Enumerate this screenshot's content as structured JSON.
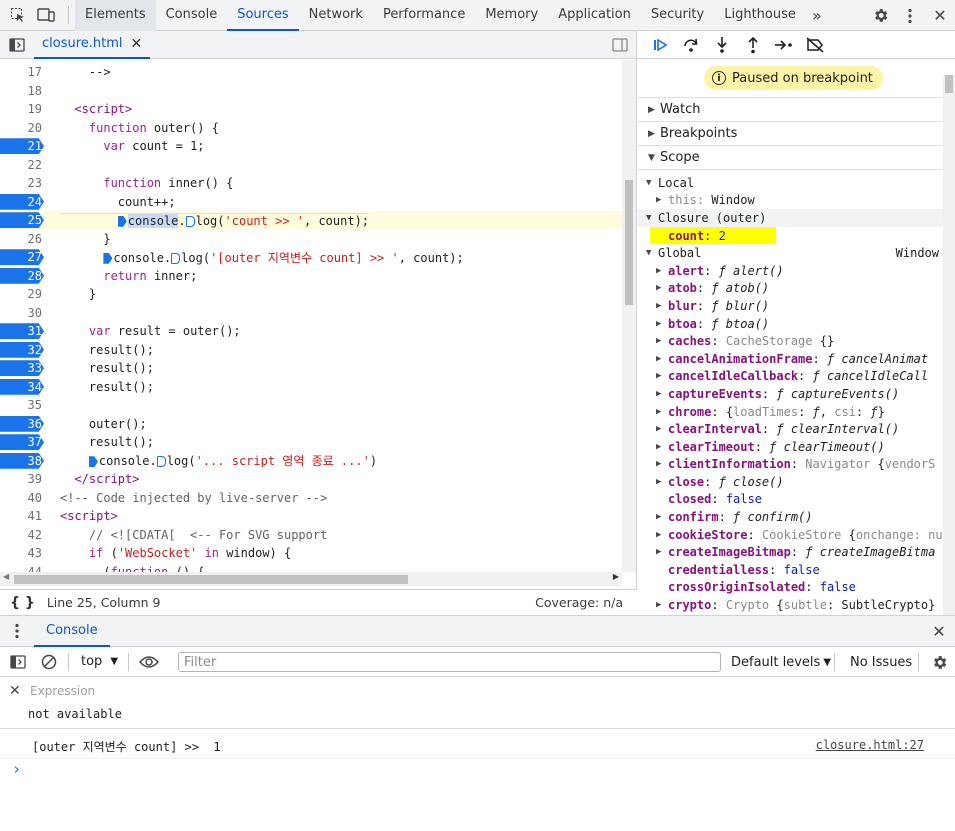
{
  "top_tabs": [
    "Elements",
    "Console",
    "Sources",
    "Network",
    "Performance",
    "Memory",
    "Application",
    "Security",
    "Lighthouse"
  ],
  "active_tab": "Sources",
  "file_tab": "closure.html",
  "code_lines": [
    {
      "n": "17",
      "bp": false,
      "html": "    -->"
    },
    {
      "n": "18",
      "bp": false,
      "html": ""
    },
    {
      "n": "19",
      "bp": false,
      "html": "  <span class='tag'>&lt;script&gt;</span>"
    },
    {
      "n": "20",
      "bp": false,
      "html": "    <span class='kw'>function</span> outer() {"
    },
    {
      "n": "21",
      "bp": true,
      "html": "      <span class='kw'>var</span> count = 1;"
    },
    {
      "n": "22",
      "bp": false,
      "html": ""
    },
    {
      "n": "23",
      "bp": false,
      "html": "      <span class='kw'>function</span> inner() {"
    },
    {
      "n": "24",
      "bp": true,
      "html": "        count++;"
    },
    {
      "n": "25",
      "bp": true,
      "current": true,
      "html": "        <span class='inline-bp'></span><span class='hsel'>console</span>.<span class='inline-bp light'></span>log(<span class='str'>'count &gt;&gt; '</span>, count);"
    },
    {
      "n": "26",
      "bp": false,
      "html": "      }"
    },
    {
      "n": "27",
      "bp": true,
      "html": "      <span class='inline-bp'></span>console.<span class='inline-bp light'></span>log(<span class='str'>'[outer 지역변수 count] &gt;&gt; '</span>, count);"
    },
    {
      "n": "28",
      "bp": true,
      "html": "      <span class='kw'>return</span> inner;"
    },
    {
      "n": "29",
      "bp": false,
      "html": "    }"
    },
    {
      "n": "30",
      "bp": false,
      "html": ""
    },
    {
      "n": "31",
      "bp": true,
      "html": "    <span class='kw'>var</span> result = outer();"
    },
    {
      "n": "32",
      "bp": true,
      "html": "    result();"
    },
    {
      "n": "33",
      "bp": true,
      "html": "    result();"
    },
    {
      "n": "34",
      "bp": true,
      "html": "    result();"
    },
    {
      "n": "35",
      "bp": false,
      "html": ""
    },
    {
      "n": "36",
      "bp": true,
      "html": "    outer();"
    },
    {
      "n": "37",
      "bp": true,
      "html": "    result();"
    },
    {
      "n": "38",
      "bp": true,
      "html": "    <span class='inline-bp'></span>console.<span class='inline-bp light'></span>log(<span class='str'>'... script 영역 종료 ...'</span>)"
    },
    {
      "n": "39",
      "bp": false,
      "html": "  <span class='tag'>&lt;/script&gt;</span>"
    },
    {
      "n": "40",
      "bp": false,
      "html": "<span class='cmt'>&lt;!-- Code injected by live-server --&gt;</span>"
    },
    {
      "n": "41",
      "bp": false,
      "html": "<span class='tag'>&lt;script&gt;</span>"
    },
    {
      "n": "42",
      "bp": false,
      "html": "    <span class='cmt'>// &lt;![CDATA[  &lt;-- For SVG support</span>"
    },
    {
      "n": "43",
      "bp": false,
      "html": "    <span class='kw'>if</span> (<span class='str'>'WebSocket'</span> <span class='kw'>in</span> window) {"
    },
    {
      "n": "44",
      "bp": false,
      "html": "      (<span class='kw'>function</span> () {"
    }
  ],
  "status": {
    "position": "Line 25, Column 9",
    "coverage": "Coverage: n/a"
  },
  "paused_label": "Paused on breakpoint",
  "sections": {
    "watch": "Watch",
    "breakpoints": "Breakpoints",
    "scope": "Scope"
  },
  "scope": {
    "local_label": "Local",
    "this_key": "this",
    "this_val": "Window",
    "closure_label": "Closure (outer)",
    "count_key": "count",
    "count_val": "2",
    "global_label": "Global",
    "global_val": "Window"
  },
  "globals": [
    {
      "k": "alert",
      "html": "<span class='fn'>ƒ alert()</span>",
      "arrow": true
    },
    {
      "k": "atob",
      "html": "<span class='fn'>ƒ atob()</span>",
      "arrow": true
    },
    {
      "k": "blur",
      "html": "<span class='fn'>ƒ blur()</span>",
      "arrow": true
    },
    {
      "k": "btoa",
      "html": "<span class='fn'>ƒ btoa()</span>",
      "arrow": true
    },
    {
      "k": "caches",
      "html": "<span class='gray'>CacheStorage </span>{}",
      "arrow": true
    },
    {
      "k": "cancelAnimationFrame",
      "html": "<span class='fn'>ƒ cancelAnimat</span>",
      "arrow": true
    },
    {
      "k": "cancelIdleCallback",
      "html": "<span class='fn'>ƒ cancelIdleCall</span>",
      "arrow": true
    },
    {
      "k": "captureEvents",
      "html": "<span class='fn'>ƒ captureEvents()</span>",
      "arrow": true
    },
    {
      "k": "chrome",
      "html": "{<span class='gray'>loadTimes</span>: <span class='fn'>ƒ</span>, <span class='gray'>csi</span>: <span class='fn'>ƒ</span>}",
      "arrow": true
    },
    {
      "k": "clearInterval",
      "html": "<span class='fn'>ƒ clearInterval()</span>",
      "arrow": true
    },
    {
      "k": "clearTimeout",
      "html": "<span class='fn'>ƒ clearTimeout()</span>",
      "arrow": true
    },
    {
      "k": "clientInformation",
      "html": "<span class='gray'>Navigator </span>{<span class='gray'>vendorS</span>",
      "arrow": true
    },
    {
      "k": "close",
      "html": "<span class='fn'>ƒ close()</span>",
      "arrow": true
    },
    {
      "k": "closed",
      "html": "<span class='kwv'>false</span>",
      "arrow": false
    },
    {
      "k": "confirm",
      "html": "<span class='fn'>ƒ confirm()</span>",
      "arrow": true
    },
    {
      "k": "cookieStore",
      "html": "<span class='gray'>CookieStore </span>{<span class='gray'>onchange: nu</span>",
      "arrow": true
    },
    {
      "k": "createImageBitmap",
      "html": "<span class='fn'>ƒ createImageBitma</span>",
      "arrow": true
    },
    {
      "k": "credentialless",
      "html": "<span class='kwv'>false</span>",
      "arrow": false
    },
    {
      "k": "crossOriginIsolated",
      "html": "<span class='kwv'>false</span>",
      "arrow": false
    },
    {
      "k": "crypto",
      "html": "<span class='gray'>Crypto </span>{<span class='gray'>subtle</span>: SubtleCrypto}",
      "arrow": true
    }
  ],
  "drawer": {
    "tab": "Console",
    "context": "top",
    "filter_placeholder": "Filter",
    "levels": "Default levels",
    "issues": "No Issues",
    "expression_placeholder": "Expression",
    "expression_value": "not available",
    "log_text": "[outer 지역변수 count] >>  1",
    "log_source": "closure.html:27",
    "prompt": "›"
  }
}
